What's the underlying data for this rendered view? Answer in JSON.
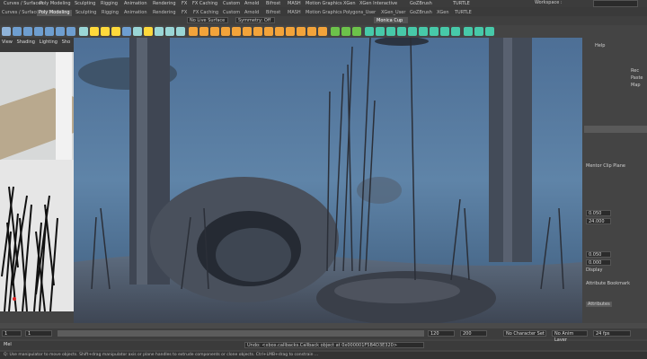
{
  "menubar": {
    "items": [
      "Curves / Surfaces",
      "Poly Modeling",
      "Sculpting",
      "Rigging",
      "Animation",
      "Rendering",
      "FX",
      "FX Caching",
      "Custom",
      "Arnold",
      "Bifrost",
      "MASH",
      "Motion Graphics",
      "XGen",
      "XGen Interactive",
      "GoZBrush",
      "TURTLE"
    ],
    "workspace_label": "Workspace :"
  },
  "shelf_tabs": [
    "Curves / Surfaces",
    "Poly Modeling",
    "Sculpting",
    "Rigging",
    "Animation",
    "Rendering",
    "FX",
    "FX Caching",
    "Custom",
    "Arnold",
    "Bifrost",
    "MASH",
    "Motion Graphics",
    "Polygons_User",
    "XGen_User",
    "GoZBrush",
    "XGen",
    "TURTLE"
  ],
  "toolbar": {
    "live_surface": "No Live Surface",
    "symmetry": "Symmetry: Off",
    "camera": "Monica Cup"
  },
  "left_panel": {
    "tabs": [
      "View",
      "Shading",
      "Lighting",
      "Sho"
    ]
  },
  "right_panel": {
    "header": [
      "Help"
    ],
    "labels": [
      "Rec",
      "Paste",
      "Map"
    ],
    "field_labels": [
      "Mentor Clip Plane"
    ],
    "values": [
      "0.050",
      "24.000",
      "0.050",
      "0.000"
    ],
    "items": [
      "Display",
      "Attributes",
      "Attribute Bookmark"
    ],
    "colors": {
      "accent": "#f0a21c"
    }
  },
  "range": {
    "start": "1",
    "start2": "1",
    "end": "120",
    "end2": "200",
    "no_character_set": "No Character Set",
    "no_anim_layer": "No Anim Layer",
    "fps": "24 fps"
  },
  "command_line": {
    "prefix": "Mel",
    "text": "Undo: <xbox.callbacks.Callback object at 0x000001F5B4D3E320>"
  },
  "help_line": {
    "text": "Q: Use manipulator to move objects. Shift+drag manipulator axis or plane handles to extrude components or clone objects. Ctrl+LMB+drag to constrain ..."
  }
}
